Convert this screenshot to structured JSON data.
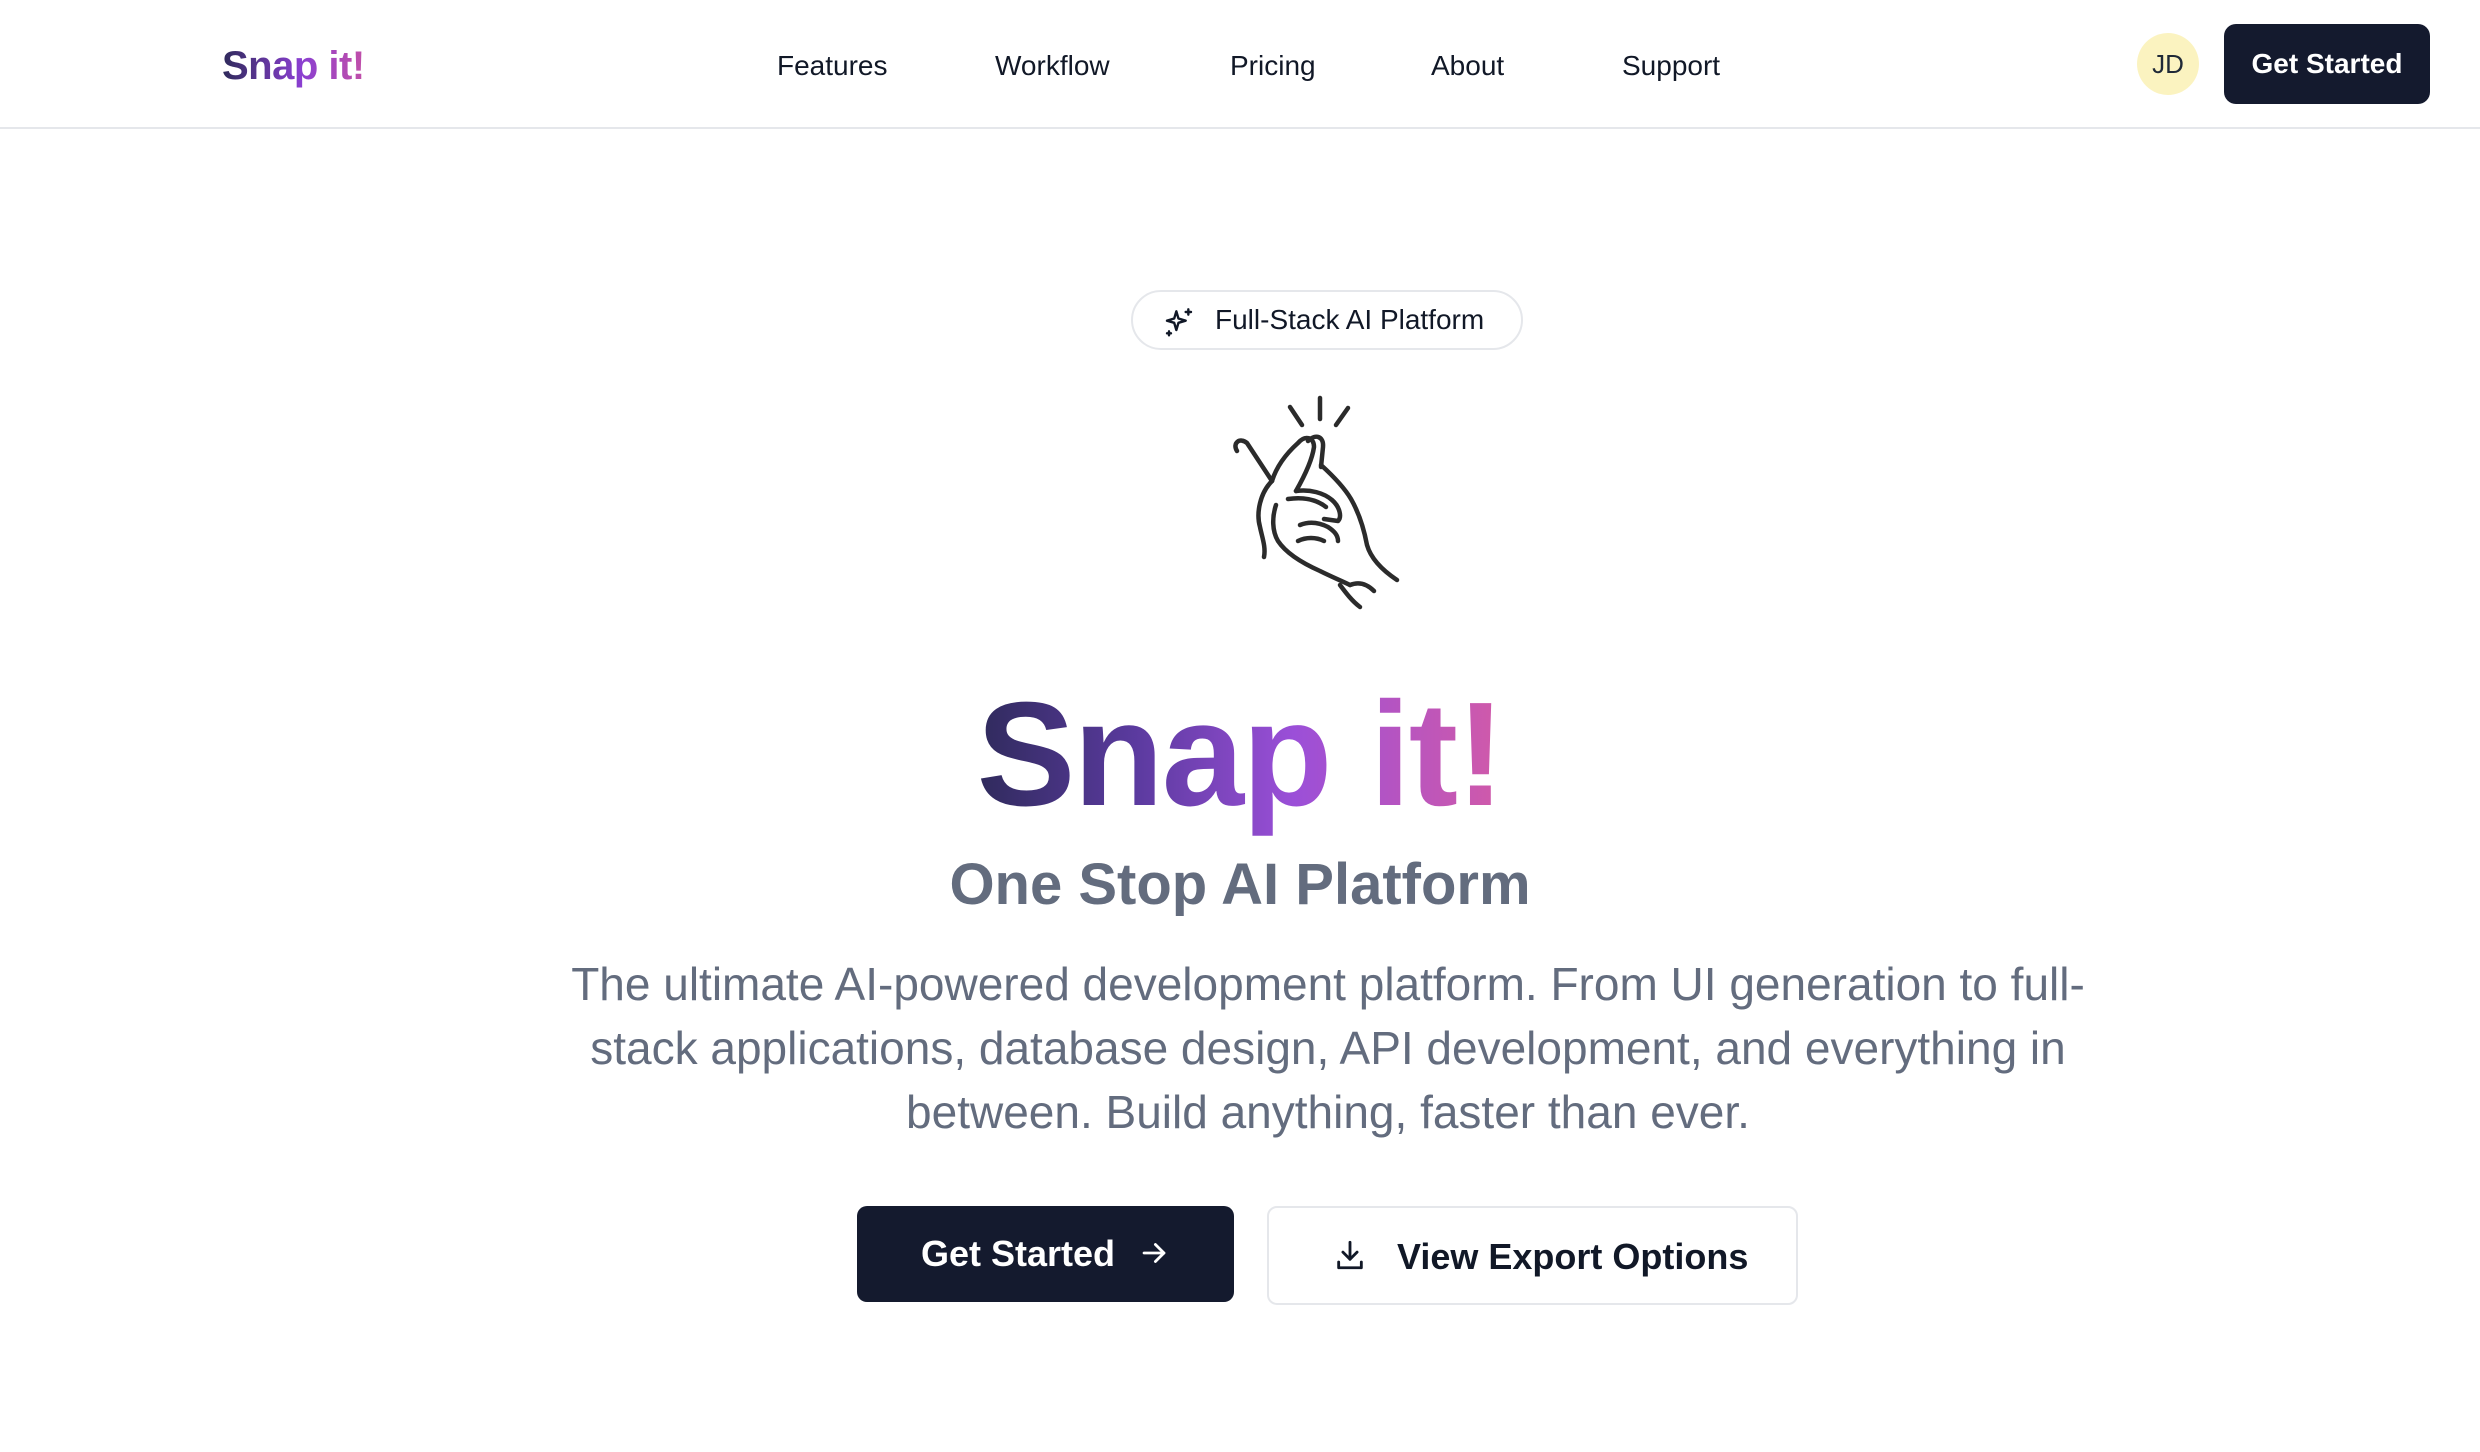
{
  "header": {
    "brand": "Snap it!",
    "nav": [
      "Features",
      "Workflow",
      "Pricing",
      "About",
      "Support"
    ],
    "avatar_initials": "JD",
    "cta_label": "Get Started"
  },
  "hero": {
    "badge_label": "Full-Stack AI Platform",
    "title": "Snap it!",
    "subtitle": "One Stop AI Platform",
    "description": "The ultimate AI-powered development platform. From UI generation to full-stack applications, database design, API development, and everything in between. Build anything, faster than ever.",
    "primary_button": "Get Started",
    "secondary_button": "View Export Options"
  },
  "icons": {
    "badge": "sparkles-icon",
    "hero_illustration": "finger-snap-icon",
    "primary_button": "arrow-right-icon",
    "secondary_button": "download-icon"
  },
  "colors": {
    "primary_dark": "#141a2e",
    "brand_gradient_start": "#2e2a5a",
    "brand_gradient_mid": "#9b4fd8",
    "brand_gradient_end": "#d25aa8",
    "muted_text": "#636c7e",
    "avatar_bg": "#fbf3c0",
    "border": "#e5e7eb"
  }
}
